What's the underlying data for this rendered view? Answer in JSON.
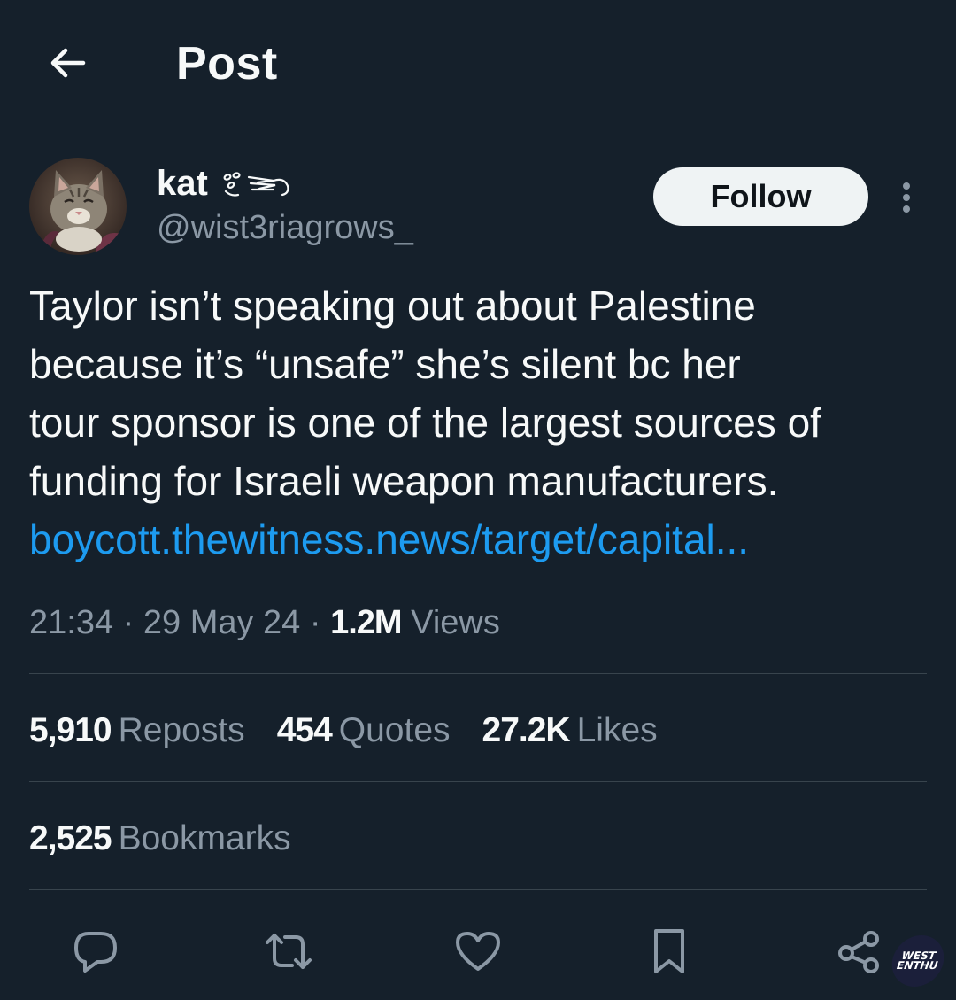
{
  "header": {
    "back_icon": "arrow-left-icon",
    "title": "Post"
  },
  "author": {
    "display_name": "kat",
    "handle": "@wist3riagrows_",
    "avatar_icon": "cat-avatar",
    "name_decoration_icon": "wisteria-doodle-icon"
  },
  "actions_top": {
    "follow_label": "Follow",
    "more_icon": "more-vertical-icon"
  },
  "tweet": {
    "text": "Taylor isn’t speaking out about Palestine\nbecause it’s “unsafe” she’s silent bc her\ntour sponsor is one of the largest sources of\nfunding for Israeli weapon manufacturers.",
    "link": "boycott.thewitness.news/target/capital..."
  },
  "meta": {
    "time": "21:34",
    "sep1": " · ",
    "date": "29 May 24",
    "sep2": " · ",
    "views_count": "1.2M",
    "views_label": "Views"
  },
  "stats": {
    "reposts_count": "5,910",
    "reposts_label": "Reposts",
    "quotes_count": "454",
    "quotes_label": "Quotes",
    "likes_count": "27.2K",
    "likes_label": "Likes",
    "bookmarks_count": "2,525",
    "bookmarks_label": "Bookmarks"
  },
  "action_bar": {
    "icons": [
      "reply-icon",
      "repost-icon",
      "like-icon",
      "bookmark-icon",
      "share-icon"
    ]
  },
  "watermark": {
    "line1": "WEST",
    "line2": "ENTHU"
  },
  "colors": {
    "background": "#15202b",
    "text_primary": "#f7f9f9",
    "text_secondary": "#8b98a5",
    "link": "#1d9bf0",
    "divider": "#38444d",
    "follow_bg": "#eff3f4"
  }
}
